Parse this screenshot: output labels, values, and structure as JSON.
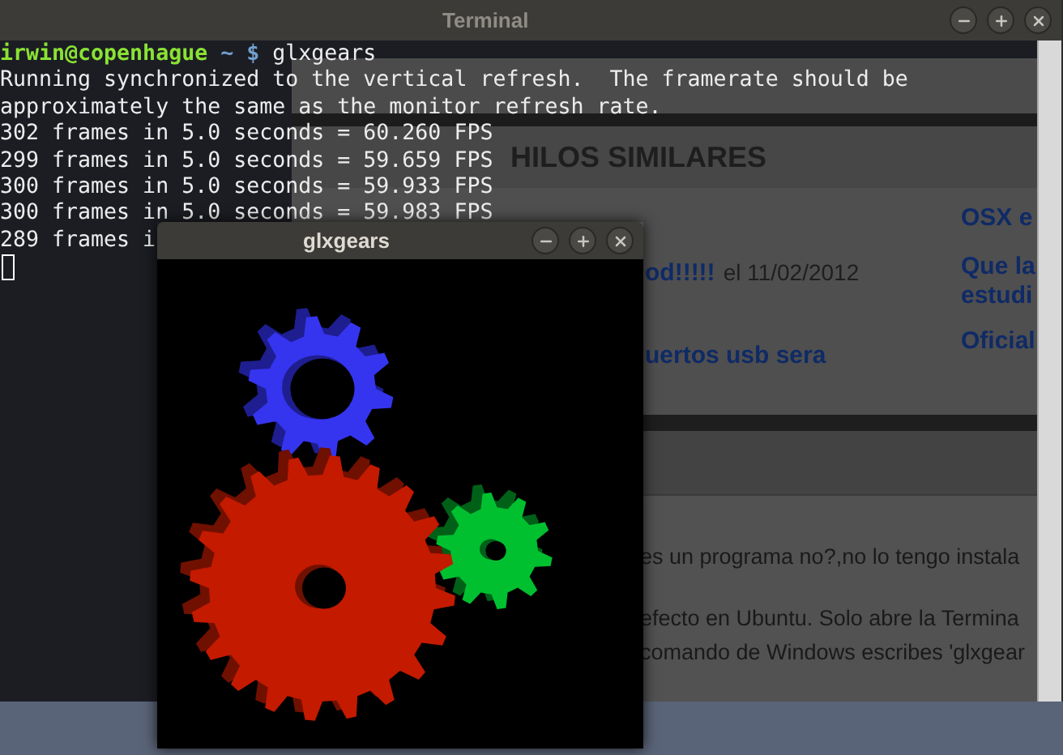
{
  "terminal": {
    "title": "Terminal",
    "prompt": {
      "user_host": "irwin@copenhague",
      "path": "~",
      "symbol": "$",
      "command": "glxgears"
    },
    "lines": [
      "Running synchronized to the vertical refresh.  The framerate should be",
      "approximately the same as the monitor refresh rate.",
      "302 frames in 5.0 seconds = 60.260 FPS",
      "299 frames in 5.0 seconds = 59.659 FPS",
      "300 frames in 5.0 seconds = 59.933 FPS",
      "300 frames in 5.0 seconds = 59.983 FPS",
      "289 frames i"
    ]
  },
  "browser": {
    "heading": "HILOS SIMILARES",
    "threads": [
      {
        "title": "od!!!!!",
        "date": "el 11/02/2012"
      },
      {
        "title": "uertos usb sera"
      }
    ],
    "side_links": [
      "OSX e",
      "Que la",
      "estudi",
      "Oficial"
    ],
    "post_lines": [
      "es un programa no?,no lo tengo instala",
      "efecto en Ubuntu. Solo abre la Termina",
      "comando de Windows escribes 'glxgear"
    ]
  },
  "glxgears": {
    "title": "glxgears"
  }
}
